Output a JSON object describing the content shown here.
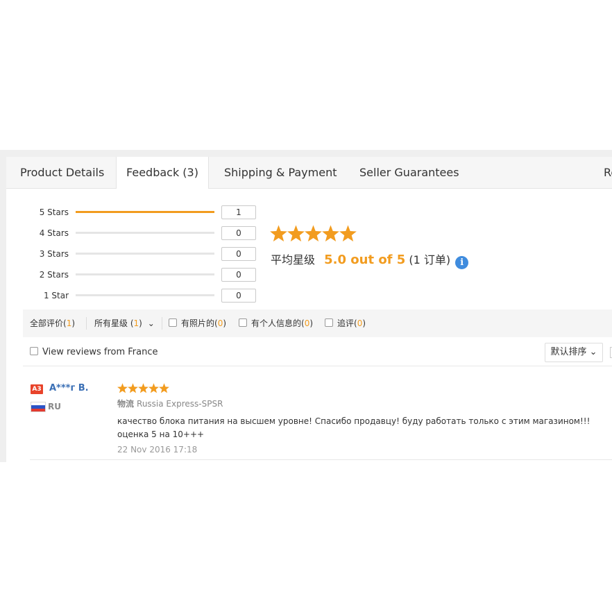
{
  "tabs": [
    {
      "label": "Product Details"
    },
    {
      "label": "Feedback (3)",
      "active": true
    },
    {
      "label": "Shipping & Payment"
    },
    {
      "label": "Seller Guarantees"
    },
    {
      "label": "Re"
    }
  ],
  "histogram": [
    {
      "label": "5 Stars",
      "count": "1",
      "fraction": 1.0
    },
    {
      "label": "4 Stars",
      "count": "0",
      "fraction": 0
    },
    {
      "label": "3 Stars",
      "count": "0",
      "fraction": 0
    },
    {
      "label": "2 Stars",
      "count": "0",
      "fraction": 0
    },
    {
      "label": "1 Star",
      "count": "0",
      "fraction": 0
    }
  ],
  "summary": {
    "stars": 5,
    "avg_label": "平均星级",
    "avg_score": "5.0 out of 5",
    "orders": "(1 订单)",
    "info_icon": "i"
  },
  "filters": {
    "all": {
      "label": "全部评价",
      "open": "(",
      "count": "1",
      "close": ")"
    },
    "stars": {
      "label": "所有星级",
      "open": "(",
      "count": "1",
      "close": ")",
      "chevron": "⌄"
    },
    "photos": {
      "label": "有照片的",
      "open": "(",
      "count": "0",
      "close": ")"
    },
    "personal": {
      "label": "有个人信息的",
      "open": "(",
      "count": "0",
      "close": ")"
    },
    "followup": {
      "label": "追评",
      "open": "(",
      "count": "0",
      "close": ")"
    }
  },
  "country_filter": {
    "label": "View reviews from France"
  },
  "sort": {
    "label": "默认排序",
    "chevron": "⌄"
  },
  "review": {
    "badge": "A3",
    "user": "А***г В.",
    "country": "RU",
    "stars": 5,
    "logistics_label": "物流",
    "logistics": "Russia Express-SPSR",
    "text": "качество блока питания на высшем уровне! Спасибо продавцу! буду работать только с этим магазином!!! оценка 5 на 10+++",
    "date": "22 Nov 2016 17:18"
  },
  "colors": {
    "accent": "#f29c1f",
    "link": "#3a6fb5",
    "info": "#3f8cde",
    "badge": "#e8432a"
  }
}
